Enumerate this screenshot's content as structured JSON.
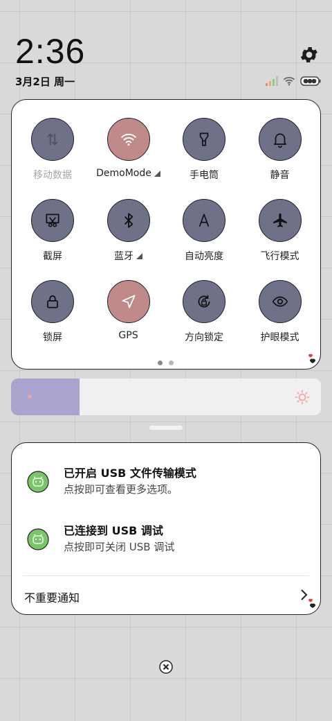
{
  "status": {
    "time": "2:36",
    "date": "3月2日 周一"
  },
  "quick_settings": {
    "tiles": [
      {
        "label": "移动数据",
        "icon": "mobile-data-icon",
        "state": "disabled"
      },
      {
        "label": "DemoMode",
        "icon": "wifi-icon",
        "state": "on",
        "expand": true
      },
      {
        "label": "手电筒",
        "icon": "flashlight-icon",
        "state": "off"
      },
      {
        "label": "静音",
        "icon": "bell-icon",
        "state": "off"
      },
      {
        "label": "截屏",
        "icon": "screenshot-icon",
        "state": "off"
      },
      {
        "label": "蓝牙",
        "icon": "bluetooth-icon",
        "state": "off",
        "expand": true
      },
      {
        "label": "自动亮度",
        "icon": "auto-brightness-icon",
        "state": "off"
      },
      {
        "label": "飞行模式",
        "icon": "airplane-icon",
        "state": "off"
      },
      {
        "label": "锁屏",
        "icon": "lock-icon",
        "state": "off"
      },
      {
        "label": "GPS",
        "icon": "location-icon",
        "state": "on"
      },
      {
        "label": "方向锁定",
        "icon": "rotation-lock-icon",
        "state": "off"
      },
      {
        "label": "护眼模式",
        "icon": "eye-icon",
        "state": "off"
      }
    ],
    "page_count": 2,
    "active_page": 1
  },
  "brightness": {
    "level": 0.22
  },
  "notifications": [
    {
      "title": "已开启 USB 文件传输模式",
      "subtitle": "点按即可查看更多选项。",
      "icon": "android-icon"
    },
    {
      "title": "已连接到 USB 调试",
      "subtitle": "点按即可关闭 USB 调试",
      "icon": "android-icon"
    }
  ],
  "unimportant_label": "不重要通知",
  "colors": {
    "tile_off": "#6f7189",
    "tile_on": "#c08a8b",
    "brightness_fill": "#a8a3cf",
    "notif_icon": "#7ac46a"
  }
}
